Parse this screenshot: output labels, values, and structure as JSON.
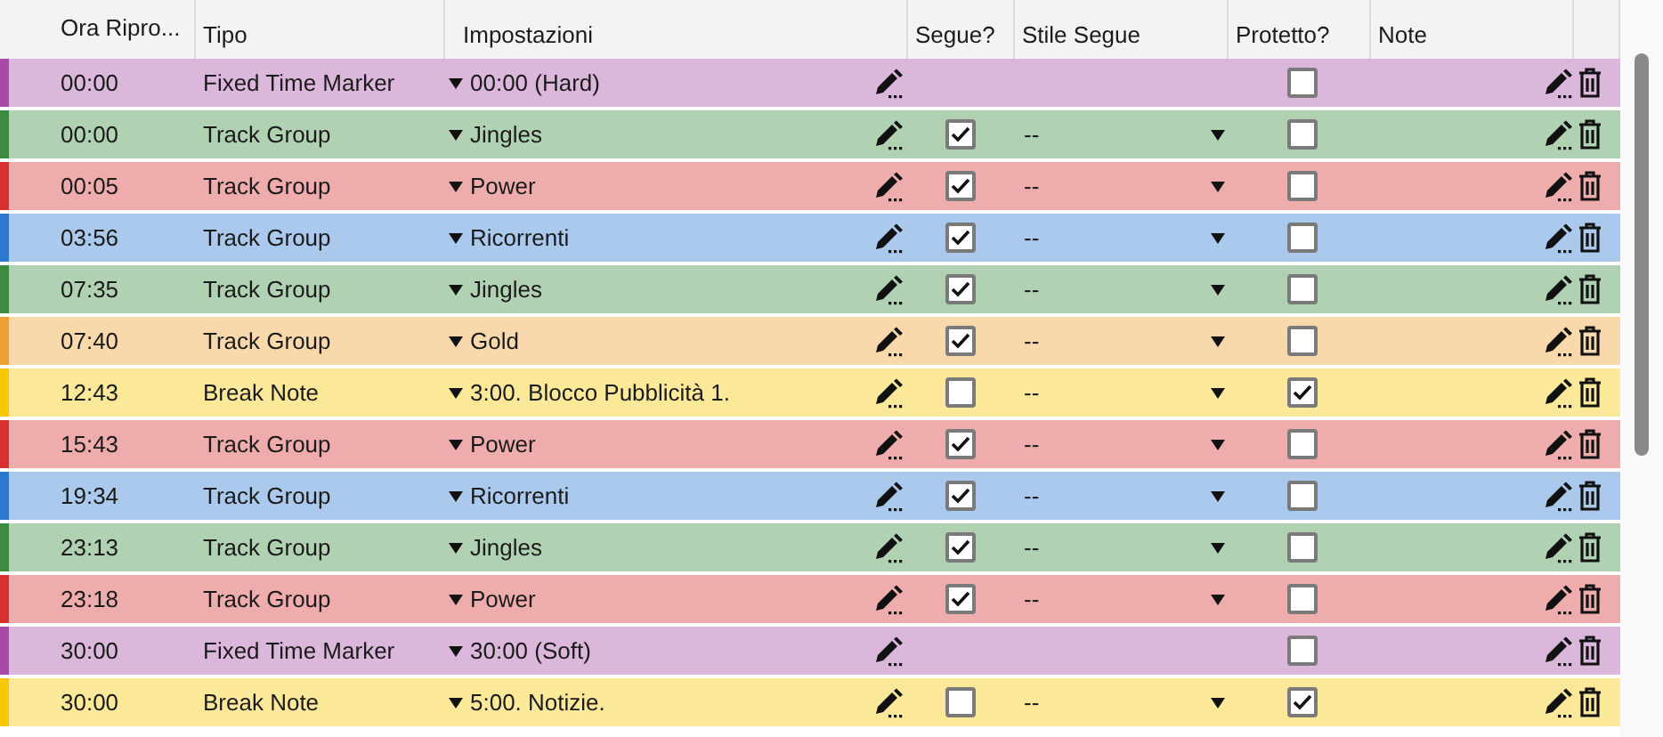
{
  "columns": [
    "Ora Ripro...",
    "Tipo",
    "Impostazioni",
    "Segue?",
    "Stile Segue",
    "Protetto?",
    "Note"
  ],
  "rows": [
    {
      "time": "00:00",
      "type": "Fixed Time Marker",
      "setting": "00:00 (Hard)",
      "protected": false,
      "color": "#a64ca6"
    },
    {
      "time": "00:00",
      "type": "Track Group",
      "setting": "Jingles",
      "segue": true,
      "segue_style": "--",
      "protected": false,
      "color": "#3c8c40"
    },
    {
      "time": "00:05",
      "type": "Track Group",
      "setting": "Power",
      "segue": true,
      "segue_style": "--",
      "protected": false,
      "color": "#d83030"
    },
    {
      "time": "03:56",
      "type": "Track Group",
      "setting": "Ricorrenti",
      "segue": true,
      "segue_style": "--",
      "protected": false,
      "color": "#2a78d0"
    },
    {
      "time": "07:35",
      "type": "Track Group",
      "setting": "Jingles",
      "segue": true,
      "segue_style": "--",
      "protected": false,
      "color": "#3c8c40"
    },
    {
      "time": "07:40",
      "type": "Track Group",
      "setting": "Gold",
      "segue": true,
      "segue_style": "--",
      "protected": false,
      "color": "#f0a030"
    },
    {
      "time": "12:43",
      "type": "Break Note",
      "setting": "3:00. Blocco Pubblicità 1.",
      "segue": false,
      "segue_style": "--",
      "protected": true,
      "color": "#f5c800"
    },
    {
      "time": "15:43",
      "type": "Track Group",
      "setting": "Power",
      "segue": true,
      "segue_style": "--",
      "protected": false,
      "color": "#d83030"
    },
    {
      "time": "19:34",
      "type": "Track Group",
      "setting": "Ricorrenti",
      "segue": true,
      "segue_style": "--",
      "protected": false,
      "color": "#2a78d0"
    },
    {
      "time": "23:13",
      "type": "Track Group",
      "setting": "Jingles",
      "segue": true,
      "segue_style": "--",
      "protected": false,
      "color": "#3c8c40"
    },
    {
      "time": "23:18",
      "type": "Track Group",
      "setting": "Power",
      "segue": true,
      "segue_style": "--",
      "protected": false,
      "color": "#d83030"
    },
    {
      "time": "30:00",
      "type": "Fixed Time Marker",
      "setting": "30:00 (Soft)",
      "protected": false,
      "color": "#a64ca6"
    },
    {
      "time": "30:00",
      "type": "Break Note",
      "setting": "5:00. Notizie.",
      "segue": false,
      "segue_style": "--",
      "protected": true,
      "color": "#f5c800"
    }
  ]
}
